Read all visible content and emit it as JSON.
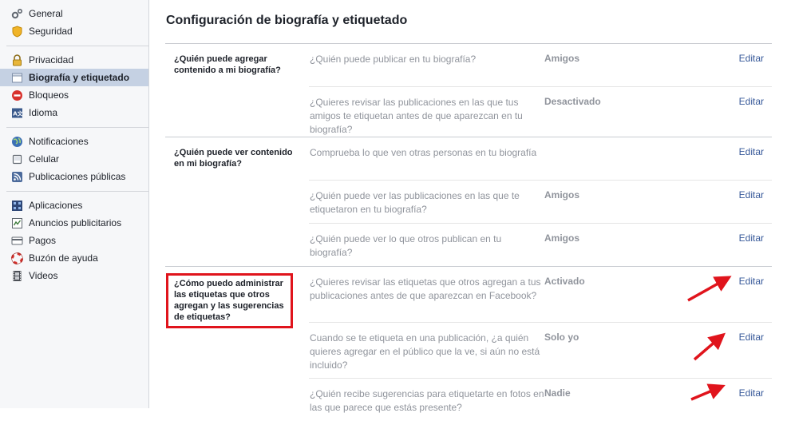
{
  "sidebar": {
    "groups": [
      {
        "items": [
          {
            "label": "General",
            "icon": "gears-icon"
          },
          {
            "label": "Seguridad",
            "icon": "badge-icon"
          }
        ]
      },
      {
        "items": [
          {
            "label": "Privacidad",
            "icon": "lock-icon"
          },
          {
            "label": "Biografía y etiquetado",
            "icon": "timeline-icon",
            "active": true
          },
          {
            "label": "Bloqueos",
            "icon": "block-icon"
          },
          {
            "label": "Idioma",
            "icon": "language-icon"
          }
        ]
      },
      {
        "items": [
          {
            "label": "Notificaciones",
            "icon": "globe-icon"
          },
          {
            "label": "Celular",
            "icon": "mobile-icon"
          },
          {
            "label": "Publicaciones públicas",
            "icon": "rss-icon"
          }
        ]
      },
      {
        "items": [
          {
            "label": "Aplicaciones",
            "icon": "apps-icon"
          },
          {
            "label": "Anuncios publicitarios",
            "icon": "ads-icon"
          },
          {
            "label": "Pagos",
            "icon": "card-icon"
          },
          {
            "label": "Buzón de ayuda",
            "icon": "lifebuoy-icon"
          },
          {
            "label": "Videos",
            "icon": "film-icon"
          }
        ]
      }
    ]
  },
  "main": {
    "title": "Configuración de biografía y etiquetado",
    "edit_label": "Editar",
    "sections": [
      {
        "label": "¿Quién puede agregar contenido a mi biografía?",
        "rows": [
          {
            "question": "¿Quién puede publicar en tu biografía?",
            "value": "Amigos"
          },
          {
            "question": "¿Quieres revisar las publicaciones en las que tus amigos te etiquetan antes de que aparezcan en tu biografía?",
            "value": "Desactivado"
          }
        ]
      },
      {
        "label": "¿Quién puede ver contenido en mi biografía?",
        "rows": [
          {
            "question": "Comprueba lo que ven otras personas en tu biografía",
            "value": ""
          },
          {
            "question": "¿Quién puede ver las publicaciones en las que te etiquetaron en tu biografía?",
            "value": "Amigos"
          },
          {
            "question": "¿Quién puede ver lo que otros publican en tu biografía?",
            "value": "Amigos"
          }
        ]
      },
      {
        "label": "¿Cómo puedo administrar las etiquetas que otros agregan y las sugerencias de etiquetas?",
        "highlighted": true,
        "rows": [
          {
            "question": "¿Quieres revisar las etiquetas que otros agregan a tus publicaciones antes de que aparezcan en Facebook?",
            "value": "Activado"
          },
          {
            "question": "Cuando se te etiqueta en una publicación, ¿a quién quieres agregar en el público que la ve, si aún no está incluido?",
            "value": "Solo yo"
          },
          {
            "question": "¿Quién recibe sugerencias para etiquetarte en fotos en las que parece que estás presente?",
            "value": "Nadie"
          }
        ]
      }
    ]
  },
  "colors": {
    "highlight": "#e0141c",
    "link": "#365899",
    "active_bg": "#c5d1e3"
  }
}
